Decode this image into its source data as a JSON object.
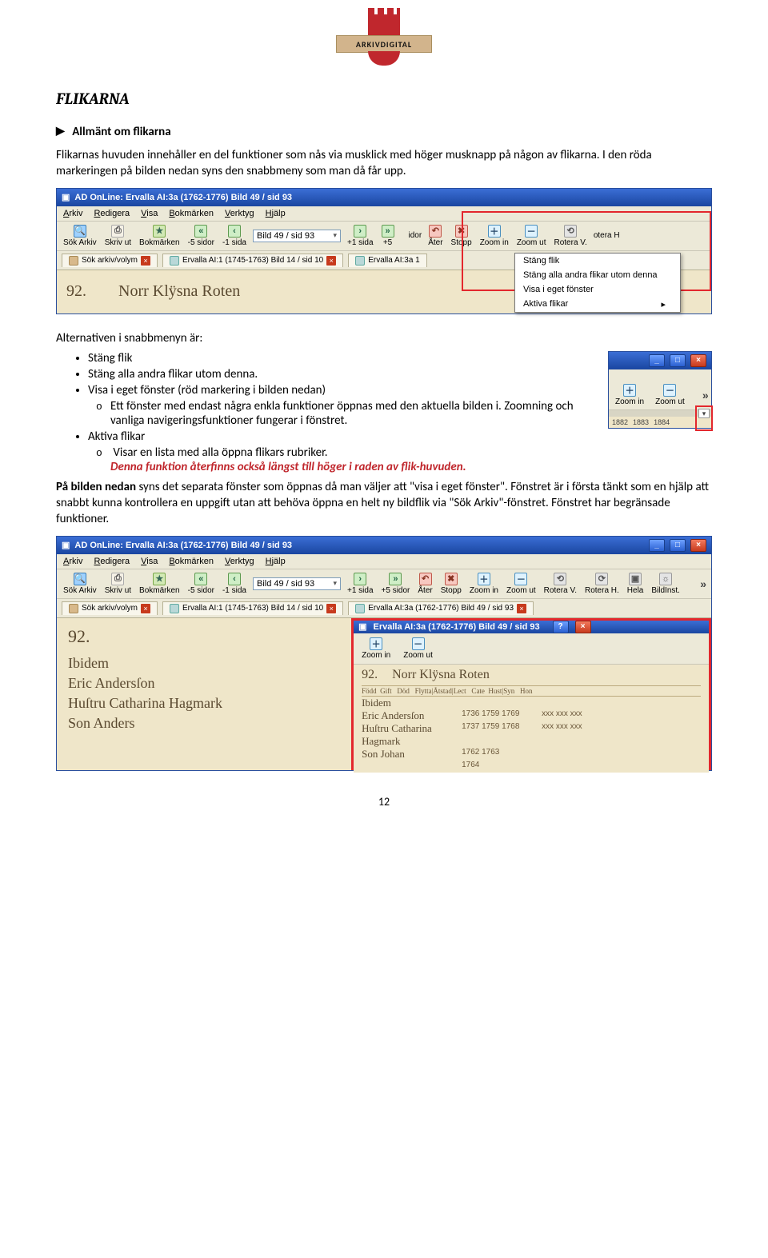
{
  "logo": {
    "text": "ARKIVDIGITAL"
  },
  "heading": "FLIKARNA",
  "subheading": "Allmänt om flikarna",
  "intro1": "Flikarnas huvuden innehåller en del funktioner som nås via musklick med höger musknapp på någon av flikarna. I den röda markeringen på bilden nedan syns den snabbmeny som man då får upp.",
  "shot1": {
    "title": "AD OnLine: Ervalla AI:3a (1762-1776) Bild 49 / sid 93",
    "menu": [
      "Arkiv",
      "Redigera",
      "Visa",
      "Bokmärken",
      "Verktyg",
      "Hjälp"
    ],
    "toolbar": {
      "sok_arkiv": "Sök Arkiv",
      "skriv_ut": "Skriv ut",
      "bokmarken": "Bokmärken",
      "minus5": "-5 sidor",
      "minus1": "-1 sida",
      "page": "Bild 49 / sid 93",
      "plus1": "+1 sida",
      "plus5": "+5",
      "ater": "Åter",
      "stopp": "Stopp",
      "zoomin": "Zoom in",
      "zoomut": "Zoom ut",
      "rotv": "Rotera V.",
      "extra_idor": "idor",
      "extra_oterah": "otera H"
    },
    "tabs": {
      "search": "Sök arkiv/volym",
      "tab1": "Ervalla AI:1 (1745-1763) Bild 14 / sid 10",
      "tab2": "Ervalla AI:3a  1"
    },
    "context": [
      "Stäng flik",
      "Stäng alla andra flikar utom denna",
      "Visa i eget fönster",
      "Aktiva flikar"
    ],
    "docnum": "92.",
    "docscript": "Norr Klÿsna Roten"
  },
  "afterShot1_lead": "Alternativen i snabbmenyn är:",
  "bullets": {
    "b1": "Stäng flik",
    "b2": "Stäng alla andra flikar utom denna.",
    "b3": "Visa i eget fönster (röd markering i bilden nedan)",
    "b3_o": "Ett fönster med endast några enkla funktioner öppnas med den aktuella bilden i. Zoomning och vanliga navigeringsfunktioner fungerar i fönstret.",
    "b4": "Aktiva flikar",
    "b4_o": "Visar en lista med alla öppna flikars rubriker.",
    "b4_red": "Denna funktion återfinns också längst till höger i raden av flik-huvuden."
  },
  "miniShot": {
    "zoomin": "Zoom in",
    "zoomut": "Zoom ut",
    "years": [
      "1882",
      "1883",
      "1884"
    ]
  },
  "para2a": "På bilden nedan",
  "para2b": " syns det separata fönster som öppnas då man väljer att \"visa i eget fönster\". Fönstret är i första tänkt som en hjälp att snabbt kunna kontrollera en uppgift utan att behöva öppna en helt ny bildflik via \"Sök Arkiv\"-fönstret. Fönstret har begränsade funktioner.",
  "shot2": {
    "title": "AD OnLine: Ervalla AI:3a (1762-1776) Bild 49 / sid 93",
    "menu": [
      "Arkiv",
      "Redigera",
      "Visa",
      "Bokmärken",
      "Verktyg",
      "Hjälp"
    ],
    "toolbar": {
      "sok_arkiv": "Sök Arkiv",
      "skriv_ut": "Skriv ut",
      "bokmarken": "Bokmärken",
      "minus5": "-5 sidor",
      "minus1": "-1 sida",
      "page": "Bild 49 / sid 93",
      "plus1": "+1 sida",
      "plus5": "+5 sidor",
      "ater": "Åter",
      "stopp": "Stopp",
      "zoomin": "Zoom in",
      "zoomut": "Zoom ut",
      "rotv": "Rotera V.",
      "roth": "Rotera H.",
      "hela": "Hela",
      "bildinst": "BildInst."
    },
    "tabs": {
      "search": "Sök arkiv/volym",
      "tab1": "Ervalla AI:1 (1745-1763) Bild 14 / sid 10",
      "tab2": "Ervalla AI:3a (1762-1776) Bild 49 / sid 93"
    },
    "ledger": {
      "num": "92.",
      "lines": [
        "Ibidem",
        "Eric Andersſon",
        "Huſtru Catharina Hagmark",
        "Son Anders"
      ]
    },
    "subwin": {
      "title": "Ervalla AI:3a (1762-1776) Bild 49 / sid 93",
      "zoomin": "Zoom in",
      "zoomut": "Zoom ut",
      "hdr_num": "92.",
      "hdr_script": "Norr Klÿsna Roten",
      "cols": "Född  Gift   Död   Flytta|Åtstad|Lect   Cate  Hust|Syn   Hon",
      "rows": [
        {
          "name": "Ibidem",
          "yrs": "",
          "xs": ""
        },
        {
          "name": "Eric Andersſon",
          "yrs": "1736  1759  1769",
          "xs": "xxx    xxx    xxx"
        },
        {
          "name": "Huſtru Catharina Hagmark",
          "yrs": "1737  1759  1768",
          "xs": "xxx    xxx    xxx"
        },
        {
          "name": "Son Johan",
          "yrs": "1762      1763",
          "xs": ""
        },
        {
          "name": "",
          "yrs": "1764",
          "xs": ""
        }
      ]
    }
  },
  "pageNumber": "12"
}
